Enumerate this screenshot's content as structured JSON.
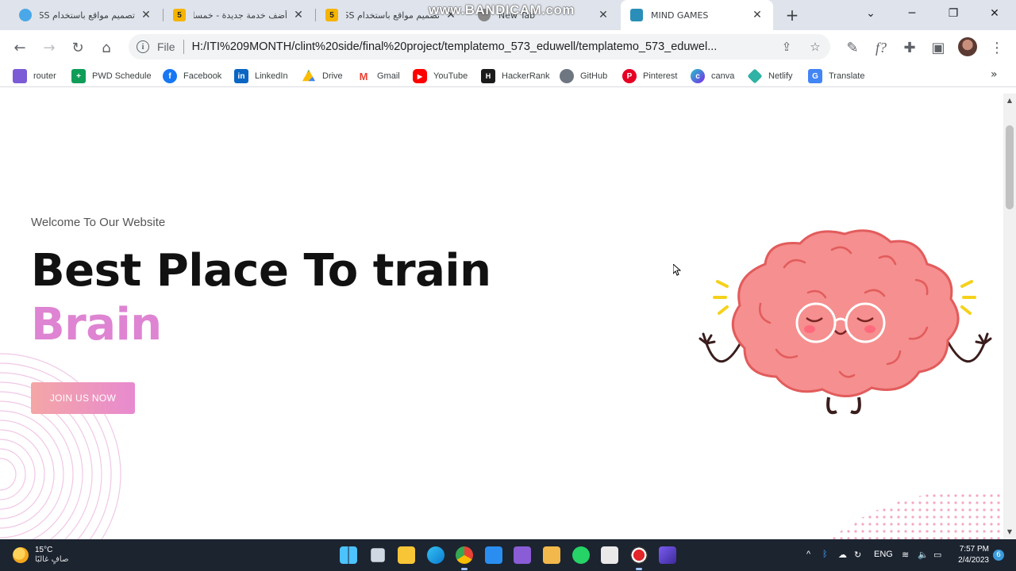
{
  "watermark": "www.BANDICAM.com",
  "tabs": [
    {
      "title": "تصميم مواقع باستخدام CSS",
      "favicon": "globe-blue"
    },
    {
      "title": "أضف خدمة جديدة - خمسات",
      "favicon": "5"
    },
    {
      "title": "تصميم مواقع باستخدام CSS",
      "favicon": "5"
    },
    {
      "title": "New Tab",
      "favicon": "chrome"
    },
    {
      "title": "MIND GAMES",
      "favicon": "mind"
    }
  ],
  "toolbar": {
    "file_label": "File",
    "url": "H:/ITI%209MONTH/clint%20side/final%20project/templatemo_573_eduwell/templatemo_573_eduwel..."
  },
  "bookmarks": [
    {
      "label": "router",
      "icon": "router-icon",
      "color": "#7b5cd6"
    },
    {
      "label": "PWD Schedule",
      "icon": "sheets-icon",
      "color": "#0f9d58"
    },
    {
      "label": "Facebook",
      "icon": "facebook-icon",
      "color": "#1877f2"
    },
    {
      "label": "LinkedIn",
      "icon": "linkedin-icon",
      "color": "#0a66c2"
    },
    {
      "label": "Drive",
      "icon": "drive-icon",
      "color": "#fbbc04"
    },
    {
      "label": "Gmail",
      "icon": "gmail-icon",
      "color": "#ea4335"
    },
    {
      "label": "YouTube",
      "icon": "youtube-icon",
      "color": "#ff0000"
    },
    {
      "label": "HackerRank",
      "icon": "hackerrank-icon",
      "color": "#1b1b1b"
    },
    {
      "label": "GitHub",
      "icon": "github-icon",
      "color": "#6e7681"
    },
    {
      "label": "Pinterest",
      "icon": "pinterest-icon",
      "color": "#e60023"
    },
    {
      "label": "canva",
      "icon": "canva-icon",
      "color": "#20c4cb"
    },
    {
      "label": "Netlify",
      "icon": "netlify-icon",
      "color": "#30b2a5"
    },
    {
      "label": "Translate",
      "icon": "translate-icon",
      "color": "#4285f4"
    }
  ],
  "hero": {
    "welcome": "Welcome To Our Website",
    "headline": "Best Place To train",
    "accent": "Brain",
    "cta": "JOIN US NOW",
    "accent_color": "#de84d2"
  },
  "taskbar": {
    "temp": "15°C",
    "condition": "صافٍ غالبًا",
    "lang": "ENG",
    "time": "7:57 PM",
    "date": "2/4/2023",
    "notifications": "6"
  }
}
